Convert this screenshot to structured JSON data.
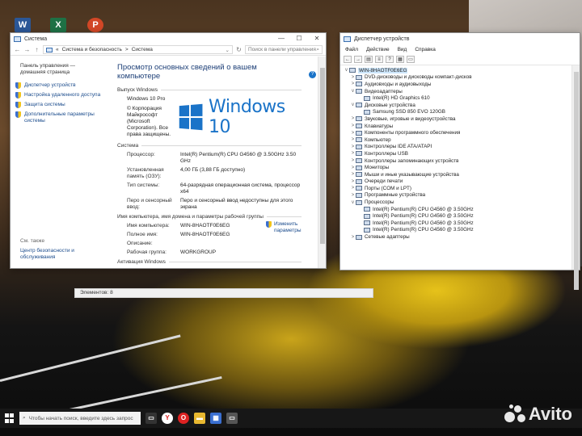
{
  "desktop_icons": [
    {
      "label": "W",
      "color": "#2b5797"
    },
    {
      "label": "X",
      "color": "#1e7145"
    },
    {
      "label": "P",
      "color": "#d24726"
    }
  ],
  "system_window": {
    "title": "Система",
    "address": {
      "part1": "Система и безопасность",
      "sep": ">",
      "part2": "Система",
      "search_placeholder": "Поиск в панели управления"
    },
    "sidebar": {
      "home": "Панель управления — домашняя страница",
      "links": [
        "Диспетчер устройств",
        "Настройка удаленного доступа",
        "Защита системы",
        "Дополнительные параметры системы"
      ],
      "see_also": "См. также",
      "see_also_link": "Центр безопасности и обслуживания"
    },
    "heading": "Просмотр основных сведений о вашем компьютере",
    "edition_section": "Выпуск Windows",
    "edition_lines": [
      "Windows 10 Pro",
      "© Корпорация Майкрософт (Microsoft Corporation). Все права защищены."
    ],
    "logo_text": "Windows 10",
    "system_section": "Система",
    "system_rows": [
      {
        "k": "Процессор:",
        "v": "Intel(R) Pentium(R) CPU G4560 @ 3.50GHz   3.50 GHz"
      },
      {
        "k": "Установленная память (ОЗУ):",
        "v": "4,00 ГБ (3,88 ГБ доступно)"
      },
      {
        "k": "Тип системы:",
        "v": "64-разрядная операционная система, процессор x64"
      },
      {
        "k": "Перо и сенсорный ввод:",
        "v": "Перо и сенсорный ввод недоступны для этого экрана"
      }
    ],
    "name_section": "Имя компьютера, имя домена и параметры рабочей группы",
    "name_rows": [
      {
        "k": "Имя компьютера:",
        "v": "WIN-8HAOTF0E6EG"
      },
      {
        "k": "Полное имя:",
        "v": "WIN-8HAOTF0E6EG"
      },
      {
        "k": "Описание:",
        "v": ""
      },
      {
        "k": "Рабочая группа:",
        "v": "WORKGROUP"
      }
    ],
    "change_link": "Изменить параметры",
    "activation_section": "Активация Windows",
    "status": "Элементов: 8"
  },
  "device_manager": {
    "title": "Диспетчер устройств",
    "menu": [
      "Файл",
      "Действие",
      "Вид",
      "Справка"
    ],
    "root": "WIN-8HAOTF0E6EG",
    "tree": [
      {
        "label": "DVD-дисководы и дисководы компакт-дисков",
        "level": 1,
        "arrow": ">"
      },
      {
        "label": "Аудиовходы и аудиовыходы",
        "level": 1,
        "arrow": ">"
      },
      {
        "label": "Видеоадаптеры",
        "level": 1,
        "arrow": "v"
      },
      {
        "label": "Intel(R) HD Graphics 610",
        "level": 2,
        "arrow": ""
      },
      {
        "label": "Дисковые устройства",
        "level": 1,
        "arrow": "v"
      },
      {
        "label": "Samsung SSD 850 EVO 120GB",
        "level": 2,
        "arrow": ""
      },
      {
        "label": "Звуковые, игровые и видеоустройства",
        "level": 1,
        "arrow": ">"
      },
      {
        "label": "Клавиатуры",
        "level": 1,
        "arrow": ">"
      },
      {
        "label": "Компоненты программного обеспечения",
        "level": 1,
        "arrow": ">"
      },
      {
        "label": "Компьютер",
        "level": 1,
        "arrow": ">"
      },
      {
        "label": "Контроллеры IDE ATA/ATAPI",
        "level": 1,
        "arrow": ">"
      },
      {
        "label": "Контроллеры USB",
        "level": 1,
        "arrow": ">"
      },
      {
        "label": "Контроллеры запоминающих устройств",
        "level": 1,
        "arrow": ">"
      },
      {
        "label": "Мониторы",
        "level": 1,
        "arrow": ">"
      },
      {
        "label": "Мыши и иные указывающие устройства",
        "level": 1,
        "arrow": ">"
      },
      {
        "label": "Очереди печати",
        "level": 1,
        "arrow": ">"
      },
      {
        "label": "Порты (COM и LPT)",
        "level": 1,
        "arrow": ">"
      },
      {
        "label": "Программные устройства",
        "level": 1,
        "arrow": ">"
      },
      {
        "label": "Процессоры",
        "level": 1,
        "arrow": "v"
      },
      {
        "label": "Intel(R) Pentium(R) CPU G4560 @ 3.50GHz",
        "level": 2,
        "arrow": ""
      },
      {
        "label": "Intel(R) Pentium(R) CPU G4560 @ 3.50GHz",
        "level": 2,
        "arrow": ""
      },
      {
        "label": "Intel(R) Pentium(R) CPU G4560 @ 3.50GHz",
        "level": 2,
        "arrow": ""
      },
      {
        "label": "Intel(R) Pentium(R) CPU G4560 @ 3.50GHz",
        "level": 2,
        "arrow": ""
      },
      {
        "label": "Сетевые адаптеры",
        "level": 1,
        "arrow": ">"
      }
    ]
  },
  "taskbar": {
    "search_placeholder": "Чтобы начать поиск, введите здесь запрос"
  },
  "watermark": "Avito"
}
